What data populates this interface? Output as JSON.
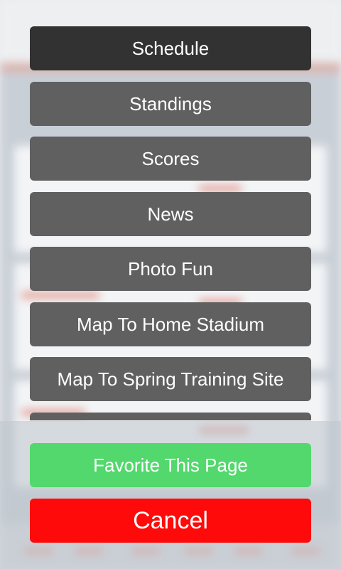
{
  "menu": {
    "items": [
      {
        "label": "Schedule",
        "active": true
      },
      {
        "label": "Standings",
        "active": false
      },
      {
        "label": "Scores",
        "active": false
      },
      {
        "label": "News",
        "active": false
      },
      {
        "label": "Photo Fun",
        "active": false
      },
      {
        "label": "Map To Home Stadium",
        "active": false
      },
      {
        "label": "Map To Spring Training Site",
        "active": false
      },
      {
        "label": "",
        "active": false
      }
    ]
  },
  "actions": {
    "favorite_label": "Favorite This Page",
    "cancel_label": "Cancel"
  },
  "colors": {
    "menu_item": "#606060",
    "menu_item_active": "#323232",
    "favorite": "#52d86c",
    "cancel": "#ff0a0a"
  }
}
